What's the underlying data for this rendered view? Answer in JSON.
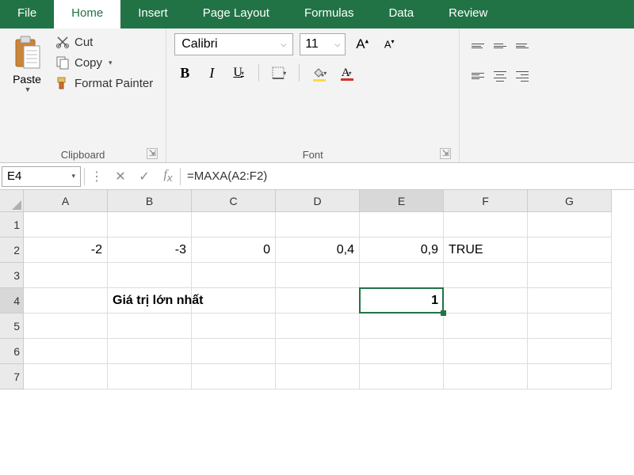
{
  "tabs": {
    "file": "File",
    "home": "Home",
    "insert": "Insert",
    "pagelayout": "Page Layout",
    "formulas": "Formulas",
    "data": "Data",
    "review": "Review"
  },
  "ribbon": {
    "clipboard": {
      "paste": "Paste",
      "cut": "Cut",
      "copy": "Copy",
      "formatpainter": "Format Painter",
      "label": "Clipboard"
    },
    "font": {
      "name": "Calibri",
      "size": "11",
      "label": "Font"
    }
  },
  "fbar": {
    "namebox": "E4",
    "formula": "=MAXA(A2:F2)"
  },
  "columns": [
    "A",
    "B",
    "C",
    "D",
    "E",
    "F",
    "G"
  ],
  "rows": [
    "1",
    "2",
    "3",
    "4",
    "5",
    "6",
    "7"
  ],
  "cells": {
    "A2": "-2",
    "B2": "-3",
    "C2": "0",
    "D2": "0,4",
    "E2": "0,9",
    "F2": "TRUE",
    "B4": "Giá trị lớn nhất",
    "E4": "1"
  },
  "selection": {
    "col": "E",
    "row": "4"
  },
  "colors": {
    "accent": "#217346"
  }
}
